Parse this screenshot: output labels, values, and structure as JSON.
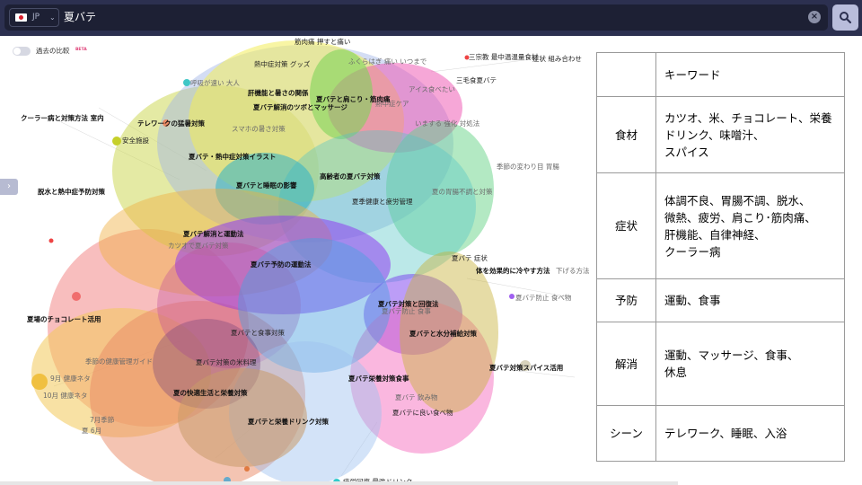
{
  "search": {
    "locale_code": "JP",
    "query": "夏バテ",
    "clear_icon": "close-circle-icon",
    "submit_icon": "search-icon"
  },
  "compare": {
    "label": "過去の比較",
    "badge": "BETA"
  },
  "graph": {
    "labels": [
      "筋肉痛 押すと痛い",
      "熱中症対策 グッズ",
      "ふくらはぎ 痛い いつまで",
      "三宗教 最中温温量食材",
      "症状 組み合わせ",
      "三毛食夏バテ",
      "呼吸が速い 大人",
      "肝機能と暑さの関係",
      "夏バテと肩こり・筋肉痛",
      "アイス食べたい",
      "夏バテ解消のツボとマッサージ",
      "熱中症ケア",
      "クーラー病と対策方法 室内",
      "テレワークの猛暑対策",
      "いまする 強化 対処法",
      "スマホの暑さ対策",
      "安全施設",
      "夏バテ・熱中症対策イラスト",
      "季節の変わり目 胃腸",
      "高齢者の夏バテ対策",
      "夏バテと睡眠の影響",
      "脱水と熱中症予防対策",
      "夏の胃腸不調と対策",
      "夏季健康と疲労管理",
      "夏バテ解消と運動法",
      "カツオで夏バテ対策",
      "夏バテ予防の運動法",
      "夏バテ 症状",
      "体を効果的に冷やす方法",
      "下げる方法",
      "夏バテ防止 食べ物",
      "夏バテ対策と回復法",
      "夏バテ防止 食事",
      "夏場のチョコレート活用",
      "夏バテと水分補給対策",
      "夏バテと食事対策",
      "季節の健康管理ガイド",
      "夏バテ対策の米料理",
      "夏バテ対策スパイス活用",
      "夏の快適生活と栄養対策",
      "夏バテ栄養対策食事",
      "9月 健康ネタ",
      "10月 健康ネタ",
      "夏バテに良い食べ物",
      "夏バテと栄養ドリンク対策",
      "7月季節",
      "夏 6月",
      "夏バテ 飲み物",
      "疲労回復 最強ドリンク"
    ]
  },
  "table": {
    "header": "キーワード",
    "rows": [
      {
        "category": "食材",
        "lines": [
          "カツオ、米、チョコレート、栄養",
          "ドリンク、味噌汁、",
          "スパイス"
        ]
      },
      {
        "category": "症状",
        "lines": [
          "体調不良、胃腸不調、脱水、",
          "微熱、疲労、肩こり･筋肉痛、",
          "肝機能、自律神経、",
          "クーラー病"
        ]
      },
      {
        "category": "予防",
        "lines": [
          "運動、食事"
        ]
      },
      {
        "category": "解消",
        "lines": [
          "運動、マッサージ、食事、",
          "休息"
        ]
      },
      {
        "category": "シーン",
        "lines": [
          "テレワーク、睡眠、入浴"
        ]
      }
    ]
  }
}
